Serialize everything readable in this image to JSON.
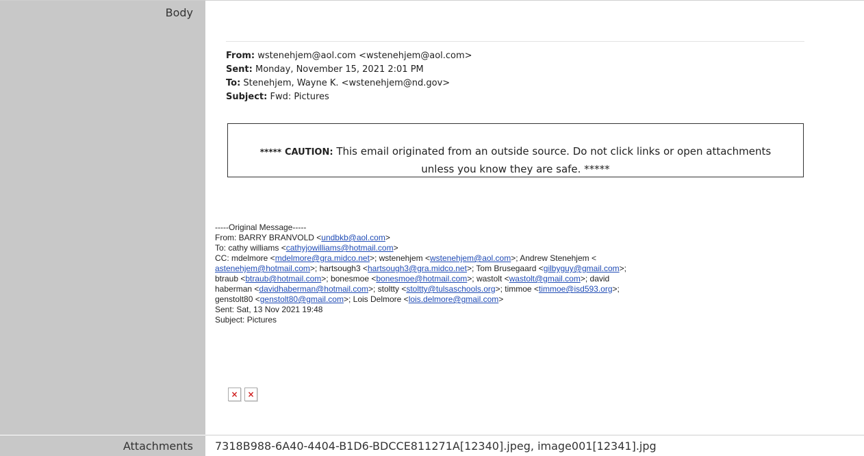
{
  "labels": {
    "body": "Body",
    "attachments": "Attachments"
  },
  "email": {
    "from_label": "From:",
    "from_value": "wstenehjem@aol.com <wstenehjem@aol.com>",
    "sent_label": "Sent:",
    "sent_value": "Monday, November 15, 2021 2:01 PM",
    "to_label": "To:",
    "to_value": "Stenehjem, Wayne K. <wstenehjem@nd.gov>",
    "subject_label": "Subject:",
    "subject_value": "Fwd: Pictures"
  },
  "caution": {
    "stars_open": "*****",
    "label": "CAUTION:",
    "line1": "This email originated from an outside source. Do not click links or open attachments",
    "line2": "unless you know they are safe. *****"
  },
  "original": {
    "header": "-----Original Message-----",
    "from_prefix": "From: BARRY BRANVOLD <",
    "from_link": "undbkb@aol.com",
    "to_prefix": "To: cathy williams <",
    "to_link": "cathyjowilliams@hotmail.com",
    "cc_prefix": "CC: mdelmore <",
    "cc_1": "mdelmore@gra.midco.net",
    "cc_t1": ">; wstenehjem <",
    "cc_2": "wstenehjem@aol.com",
    "cc_t2": ">; Andrew Stenehjem <",
    "cc_3": "astenehjem@hotmail.com",
    "cc_t3": ">; hartsough3 <",
    "cc_4": "hartsough3@gra.midco.net",
    "cc_t4": ">; Tom Brusegaard <",
    "cc_5": "gilbyguy@gmail.com",
    "cc_t5": ">;",
    "cc_t6": "btraub <",
    "cc_6": "btraub@hotmail.com",
    "cc_t7": ">; bonesmoe <",
    "cc_7": "bonesmoe@hotmail.com",
    "cc_t8": ">; wastolt <",
    "cc_8": "wastolt@gmail.com",
    "cc_t9": ">; david",
    "cc_t10": "haberman <",
    "cc_9": "davidhaberman@hotmail.com",
    "cc_t11": ">; stoltty <",
    "cc_10": "stoltty@tulsaschools.org",
    "cc_t12": ">; timmoe <",
    "cc_11": "timmoe@isd593.org",
    "cc_t13": ">;",
    "cc_t14": "genstolt80 <",
    "cc_12": "genstolt80@gmail.com",
    "cc_t15": ">; Lois Delmore <",
    "cc_13": "lois.delmore@gmail.com",
    "cc_t16": ">",
    "sent": "Sent: Sat, 13 Nov 2021 19:48",
    "subject": "Subject: Pictures"
  },
  "broken_image_glyph": "×",
  "attachments_value": "7318B988-6A40-4404-B1D6-BDCCE811271A[12340].jpeg, image001[12341].jpg"
}
